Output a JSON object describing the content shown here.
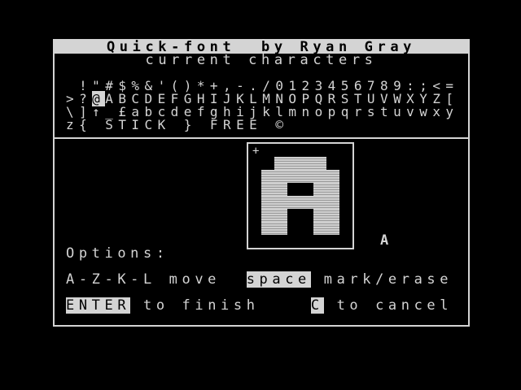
{
  "title": "Quick-font  by Ryan Gray",
  "subtitle": "current characters",
  "charset": {
    "row1": " !\"#$%&'()*+,-./0123456789:;<=",
    "row2_before": ">?",
    "row2_highlight": "@",
    "row2_after": "ABCDEFGHIJKLMNOPQRSTUVWXYZ[",
    "row3": "\\]↑_£abcdefghijklmnopqrstuvwxy",
    "row4": "z{ STICK } FREE ©"
  },
  "editor": {
    "cursor_symbol": "+",
    "current_char": "A",
    "preview_char": "A",
    "pixels_on": [
      "00000000",
      "00111100",
      "01111110",
      "01100110",
      "01111110",
      "01100110",
      "01100110",
      "00000000"
    ]
  },
  "options": {
    "heading": "Options:",
    "move_keys": "A-Z-K-L move",
    "space_key": "space",
    "space_action": "mark/erase",
    "enter_key": "ENTER",
    "enter_action": "to finish",
    "cancel_key": "C",
    "cancel_action": "to cancel"
  },
  "colors": {
    "foreground": "#d4d4d4",
    "background": "#000000"
  }
}
